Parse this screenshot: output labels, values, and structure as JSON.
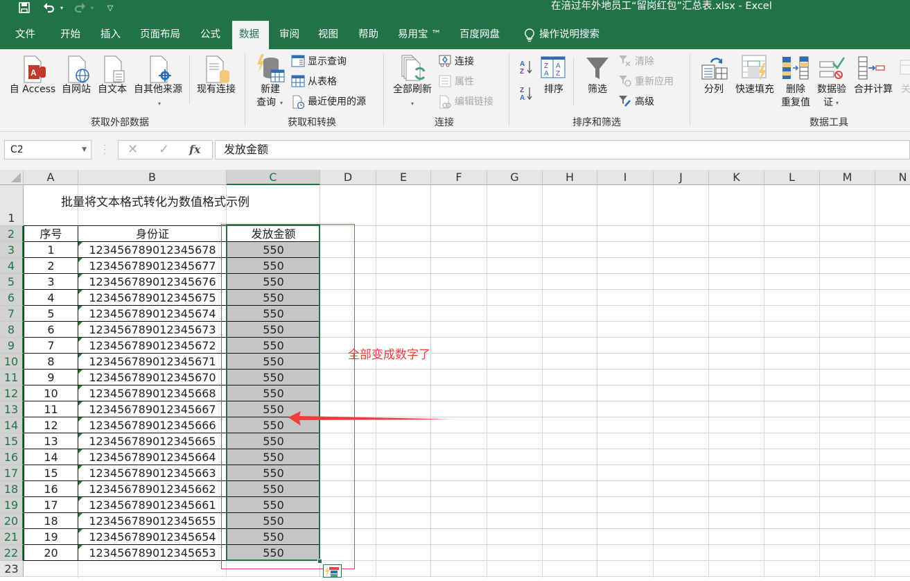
{
  "window": {
    "title": "在涪过年外地员工“留岗红包”汇总表.xlsx  -  Excel"
  },
  "quick_access": {
    "save": "save-icon",
    "undo": "undo-icon",
    "redo": "redo-icon",
    "customize": "customize-qat-icon"
  },
  "tabs": [
    {
      "label": "文件"
    },
    {
      "label": "开始"
    },
    {
      "label": "插入"
    },
    {
      "label": "页面布局"
    },
    {
      "label": "公式"
    },
    {
      "label": "数据",
      "active": true
    },
    {
      "label": "审阅"
    },
    {
      "label": "视图"
    },
    {
      "label": "帮助"
    },
    {
      "label": "易用宝 ™"
    },
    {
      "label": "百度网盘"
    }
  ],
  "tell_me": "操作说明搜索",
  "ribbon": {
    "groups": {
      "external": {
        "label": "获取外部数据",
        "buttons": [
          "自 Access",
          "自网站",
          "自文本",
          "自其他来源",
          "现有连接"
        ]
      },
      "transform": {
        "label": "获取和转换",
        "new_query_line1": "新建",
        "new_query_line2": "查询",
        "small": [
          "显示查询",
          "从表格",
          "最近使用的源"
        ]
      },
      "connections": {
        "label": "连接",
        "refresh_all": "全部刷新",
        "small": [
          "连接",
          "属性",
          "编辑链接"
        ]
      },
      "sort_filter": {
        "label": "排序和筛选",
        "sort": "排序",
        "filter": "筛选",
        "small": [
          "清除",
          "重新应用",
          "高级"
        ]
      },
      "data_tools": {
        "label": "数据工具",
        "buttons": [
          "分列",
          "快速填充",
          "删除",
          "数据验",
          "合并计算",
          "关"
        ],
        "buttons_line2": [
          "",
          "",
          "重复值",
          "证",
          "",
          ""
        ]
      }
    }
  },
  "formula_bar": {
    "name_box": "C2",
    "fx": "fx",
    "value": "发放金额"
  },
  "sheet": {
    "columns": [
      "A",
      "B",
      "C",
      "D",
      "E",
      "F",
      "G",
      "H",
      "I",
      "J",
      "K",
      "L",
      "M",
      "N"
    ],
    "selected_column": "C",
    "rows": [
      "1",
      "2",
      "3",
      "4",
      "5",
      "6",
      "7",
      "8",
      "9",
      "10",
      "11",
      "12",
      "13",
      "14",
      "15",
      "16",
      "17",
      "18",
      "19",
      "20",
      "21",
      "22",
      "23"
    ],
    "title": "批量将文本格式转化为数值格式示例",
    "headers": [
      "序号",
      "身份证",
      "发放金额"
    ],
    "data": [
      [
        "1",
        "123456789012345678",
        "550"
      ],
      [
        "2",
        "123456789012345677",
        "550"
      ],
      [
        "3",
        "123456789012345676",
        "550"
      ],
      [
        "4",
        "123456789012345675",
        "550"
      ],
      [
        "5",
        "123456789012345674",
        "550"
      ],
      [
        "6",
        "123456789012345673",
        "550"
      ],
      [
        "7",
        "123456789012345672",
        "550"
      ],
      [
        "8",
        "123456789012345671",
        "550"
      ],
      [
        "9",
        "123456789012345670",
        "550"
      ],
      [
        "10",
        "123456789012345668",
        "550"
      ],
      [
        "11",
        "123456789012345667",
        "550"
      ],
      [
        "12",
        "123456789012345666",
        "550"
      ],
      [
        "13",
        "123456789012345665",
        "550"
      ],
      [
        "14",
        "123456789012345664",
        "550"
      ],
      [
        "15",
        "123456789012345663",
        "550"
      ],
      [
        "16",
        "123456789012345662",
        "550"
      ],
      [
        "17",
        "123456789012345661",
        "550"
      ],
      [
        "18",
        "123456789012345655",
        "550"
      ],
      [
        "19",
        "123456789012345654",
        "550"
      ],
      [
        "20",
        "123456789012345653",
        "550"
      ]
    ],
    "annotation": "全部变成数字了",
    "annotation_color": "#f03c3c",
    "accent": "#217346"
  }
}
